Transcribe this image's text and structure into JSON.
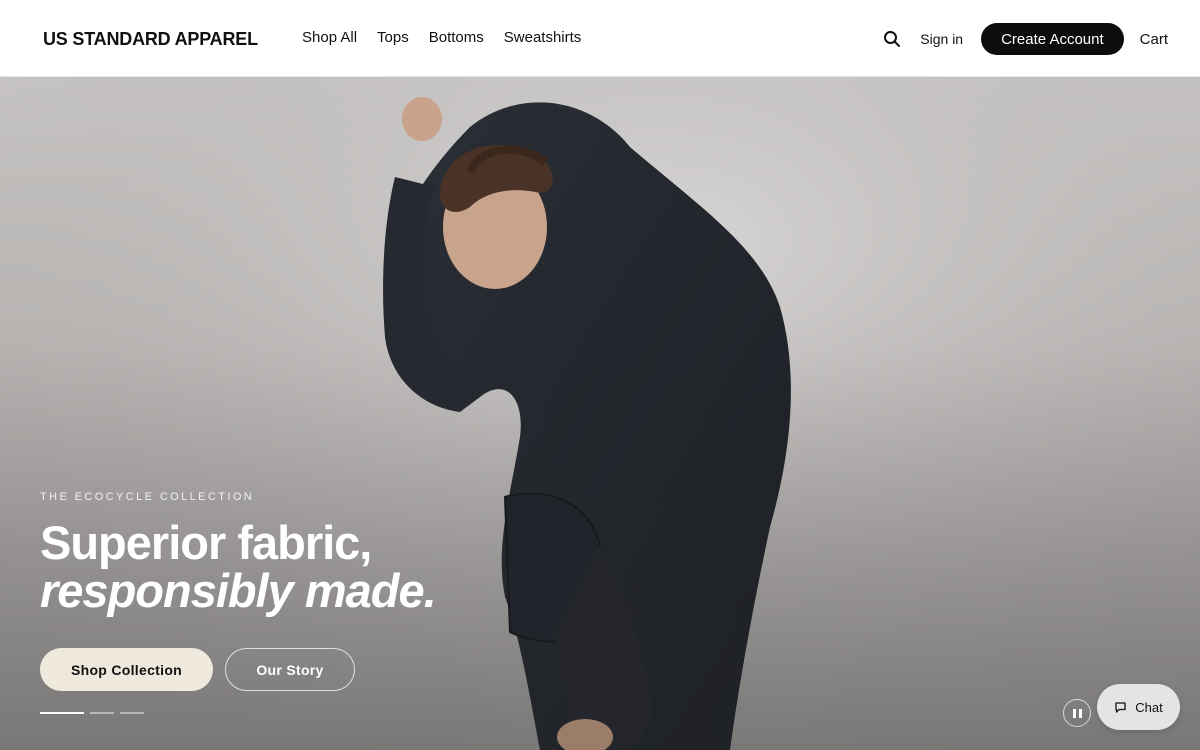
{
  "header": {
    "logo": "US STANDARD APPAREL",
    "nav": [
      "Shop All",
      "Tops",
      "Bottoms",
      "Sweatshirts"
    ],
    "search_icon": "search-icon",
    "signin_label": "Sign in",
    "create_account_label": "Create Account",
    "cart_label": "Cart"
  },
  "hero": {
    "eyebrow": "THE ECOCYCLE COLLECTION",
    "headline_line1": "Superior fabric,",
    "headline_line2": "responsibly made.",
    "primary_cta": "Shop Collection",
    "secondary_cta": "Our Story",
    "slides_count": 3,
    "active_slide": 1,
    "pause_icon": "pause-icon"
  },
  "chat": {
    "label": "Chat",
    "icon": "chat-bubble-icon"
  },
  "colors": {
    "header_bg": "#ffffff",
    "primary_button_bg": "#0d0d0d",
    "cta_cream": "#efe9dd",
    "hoodie": "#23262c"
  }
}
